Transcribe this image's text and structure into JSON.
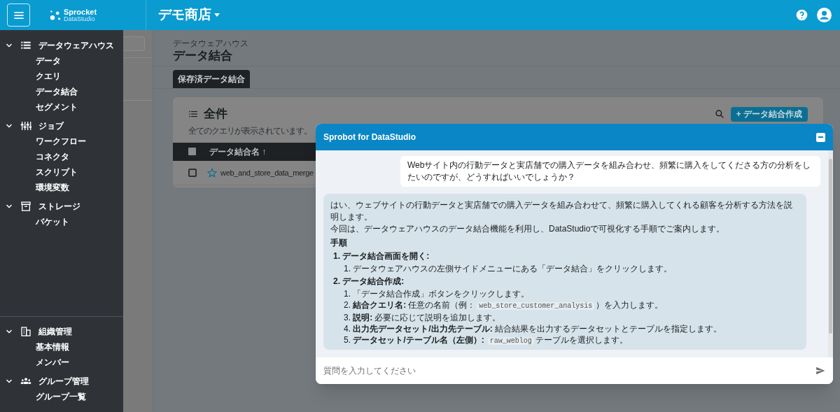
{
  "header": {
    "logo_name": "Sprocket",
    "logo_sub": "DataStudio",
    "workspace": "デモ商店"
  },
  "sidebar": {
    "sections": [
      {
        "kind": "list",
        "label": "データウェアハウス",
        "expanded": true,
        "items": [
          "データ",
          "クエリ",
          "データ結合",
          "セグメント"
        ]
      },
      {
        "kind": "sliders",
        "label": "ジョブ",
        "expanded": true,
        "items": [
          "ワークフロー",
          "コネクタ",
          "スクリプト",
          "環境変数"
        ]
      },
      {
        "kind": "archive",
        "label": "ストレージ",
        "expanded": true,
        "items": [
          "バケット"
        ]
      }
    ],
    "bottom_sections": [
      {
        "kind": "building",
        "label": "組織管理",
        "expanded": true,
        "items": [
          "基本情報",
          "メンバー"
        ]
      },
      {
        "kind": "group",
        "label": "グループ管理",
        "expanded": true,
        "items": [
          "グループ一覧"
        ]
      }
    ]
  },
  "page": {
    "breadcrumb": "データウェアハウス",
    "title": "データ結合",
    "tabs": [
      {
        "label": "保存済データ結合",
        "selected": true
      }
    ],
    "card": {
      "title": "全件",
      "subtitle": "全てのクエリが表示されています。",
      "create_button": "+ データ結合作成",
      "table": {
        "all_checked": false,
        "columns": [
          "データ結合名 ↑"
        ],
        "rows": [
          {
            "checked": false,
            "starred": false,
            "name": "web_and_store_data_merge"
          }
        ]
      }
    }
  },
  "chat": {
    "title": "Sprobot for DataStudio",
    "user_message": "Webサイト内の行動データと実店舗での購入データを組み合わせ、頻繁に購入をしてくださる方の分析をしたいのですが、どうすればいいでしょうか？",
    "bot_intro": [
      "はい、ウェブサイトの行動データと実店舗での購入データを組み合わせて、頻繁に購入してくれる顧客を分析する方法を説明します。",
      "今回は、データウェアハウスのデータ結合機能を利用し、DataStudioで可視化する手順でご案内します。"
    ],
    "bot_heading": "手順",
    "steps": [
      {
        "number": "1.",
        "title": "データ結合画面を開く:",
        "substeps": [
          {
            "number": "1.",
            "segments": [
              {
                "kind": "text",
                "text": "データウェアハウスの左側サイドメニューにある「データ結合」をクリックします。"
              }
            ]
          }
        ]
      },
      {
        "number": "2.",
        "title": "データ結合作成:",
        "substeps": [
          {
            "number": "1.",
            "segments": [
              {
                "kind": "text",
                "text": "「データ結合作成」ボタンをクリックします。"
              }
            ]
          },
          {
            "number": "2.",
            "segments": [
              {
                "kind": "bold",
                "text": "結合クエリ名:"
              },
              {
                "kind": "text",
                "text": "任意の名前（例："
              },
              {
                "kind": "code",
                "text": "web_store_customer_analysis"
              },
              {
                "kind": "text",
                "text": "）を入力します。"
              }
            ]
          },
          {
            "number": "3.",
            "segments": [
              {
                "kind": "bold",
                "text": "説明:"
              },
              {
                "kind": "text",
                "text": "必要に応じて説明を追加します。"
              }
            ]
          },
          {
            "number": "4.",
            "segments": [
              {
                "kind": "bold",
                "text": "出力先データセット/出力先テーブル:"
              },
              {
                "kind": "text",
                "text": "結合結果を出力するデータセットとテーブルを指定します。"
              }
            ]
          },
          {
            "number": "5.",
            "segments": [
              {
                "kind": "bold",
                "text": "データセット/テーブル名（左側）:"
              },
              {
                "kind": "code",
                "text": "raw_weblog"
              },
              {
                "kind": "text",
                "text": "テーブルを選択します。"
              }
            ]
          }
        ]
      }
    ],
    "input_placeholder": "質問を入力してください"
  }
}
